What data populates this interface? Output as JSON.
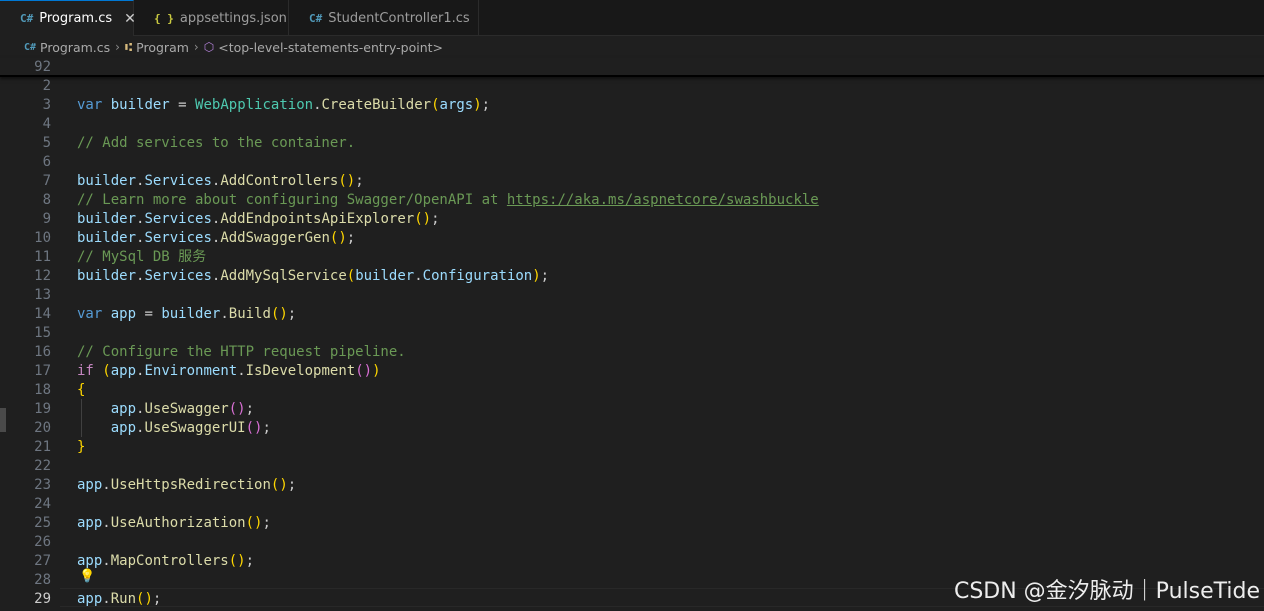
{
  "tabs": [
    {
      "icon": "C#",
      "label": "Program.cs",
      "close": "✕"
    },
    {
      "icon": "{ }",
      "label": "appsettings.json"
    },
    {
      "icon": "C#",
      "label": "StudentController1.cs"
    }
  ],
  "breadcrumb": {
    "items": [
      "Program.cs",
      "Program",
      "<top-level-statements-entry-point>"
    ]
  },
  "sticky_line_number": "92",
  "lines": [
    {
      "n": "2",
      "t": []
    },
    {
      "n": "3",
      "t": [
        [
          "kw",
          "var"
        ],
        [
          "txt",
          " "
        ],
        [
          "var",
          "builder"
        ],
        [
          "txt",
          " = "
        ],
        [
          "type",
          "WebApplication"
        ],
        [
          "txt",
          "."
        ],
        [
          "fn",
          "CreateBuilder"
        ],
        [
          "p1",
          "("
        ],
        [
          "var",
          "args"
        ],
        [
          "p1",
          ")"
        ],
        [
          "txt",
          ";"
        ]
      ]
    },
    {
      "n": "4",
      "t": []
    },
    {
      "n": "5",
      "t": [
        [
          "cmt",
          "// Add services to the container."
        ]
      ]
    },
    {
      "n": "6",
      "t": []
    },
    {
      "n": "7",
      "t": [
        [
          "var",
          "builder"
        ],
        [
          "txt",
          "."
        ],
        [
          "var",
          "Services"
        ],
        [
          "txt",
          "."
        ],
        [
          "fn",
          "AddControllers"
        ],
        [
          "p1",
          "()"
        ],
        [
          "txt",
          ";"
        ]
      ]
    },
    {
      "n": "8",
      "t": [
        [
          "cmt",
          "// Learn more about configuring Swagger/OpenAPI at "
        ],
        [
          "link",
          "https://aka.ms/aspnetcore/swashbuckle"
        ]
      ]
    },
    {
      "n": "9",
      "t": [
        [
          "var",
          "builder"
        ],
        [
          "txt",
          "."
        ],
        [
          "var",
          "Services"
        ],
        [
          "txt",
          "."
        ],
        [
          "fn",
          "AddEndpointsApiExplorer"
        ],
        [
          "p1",
          "()"
        ],
        [
          "txt",
          ";"
        ]
      ]
    },
    {
      "n": "10",
      "t": [
        [
          "var",
          "builder"
        ],
        [
          "txt",
          "."
        ],
        [
          "var",
          "Services"
        ],
        [
          "txt",
          "."
        ],
        [
          "fn",
          "AddSwaggerGen"
        ],
        [
          "p1",
          "()"
        ],
        [
          "txt",
          ";"
        ]
      ]
    },
    {
      "n": "11",
      "t": [
        [
          "cmt",
          "// MySql DB 服务"
        ]
      ]
    },
    {
      "n": "12",
      "t": [
        [
          "var",
          "builder"
        ],
        [
          "txt",
          "."
        ],
        [
          "var",
          "Services"
        ],
        [
          "txt",
          "."
        ],
        [
          "fn",
          "AddMySqlService"
        ],
        [
          "p1",
          "("
        ],
        [
          "var",
          "builder"
        ],
        [
          "txt",
          "."
        ],
        [
          "var",
          "Configuration"
        ],
        [
          "p1",
          ")"
        ],
        [
          "txt",
          ";"
        ]
      ]
    },
    {
      "n": "13",
      "t": []
    },
    {
      "n": "14",
      "t": [
        [
          "kw",
          "var"
        ],
        [
          "txt",
          " "
        ],
        [
          "var",
          "app"
        ],
        [
          "txt",
          " = "
        ],
        [
          "var",
          "builder"
        ],
        [
          "txt",
          "."
        ],
        [
          "fn",
          "Build"
        ],
        [
          "p1",
          "()"
        ],
        [
          "txt",
          ";"
        ]
      ]
    },
    {
      "n": "15",
      "t": []
    },
    {
      "n": "16",
      "t": [
        [
          "cmt",
          "// Configure the HTTP request pipeline."
        ]
      ]
    },
    {
      "n": "17",
      "t": [
        [
          "kw2",
          "if"
        ],
        [
          "txt",
          " "
        ],
        [
          "p1",
          "("
        ],
        [
          "var",
          "app"
        ],
        [
          "txt",
          "."
        ],
        [
          "var",
          "Environment"
        ],
        [
          "txt",
          "."
        ],
        [
          "fn",
          "IsDevelopment"
        ],
        [
          "p2",
          "()"
        ],
        [
          "p1",
          ")"
        ]
      ]
    },
    {
      "n": "18",
      "t": [
        [
          "p1",
          "{"
        ]
      ]
    },
    {
      "n": "19",
      "t": [
        [
          "txt",
          "    "
        ],
        [
          "var",
          "app"
        ],
        [
          "txt",
          "."
        ],
        [
          "fn",
          "UseSwagger"
        ],
        [
          "p2",
          "()"
        ],
        [
          "txt",
          ";"
        ]
      ]
    },
    {
      "n": "20",
      "t": [
        [
          "txt",
          "    "
        ],
        [
          "var",
          "app"
        ],
        [
          "txt",
          "."
        ],
        [
          "fn",
          "UseSwaggerUI"
        ],
        [
          "p2",
          "()"
        ],
        [
          "txt",
          ";"
        ]
      ]
    },
    {
      "n": "21",
      "t": [
        [
          "p1",
          "}"
        ]
      ]
    },
    {
      "n": "22",
      "t": []
    },
    {
      "n": "23",
      "t": [
        [
          "var",
          "app"
        ],
        [
          "txt",
          "."
        ],
        [
          "fn",
          "UseHttpsRedirection"
        ],
        [
          "p1",
          "()"
        ],
        [
          "txt",
          ";"
        ]
      ]
    },
    {
      "n": "24",
      "t": []
    },
    {
      "n": "25",
      "t": [
        [
          "var",
          "app"
        ],
        [
          "txt",
          "."
        ],
        [
          "fn",
          "UseAuthorization"
        ],
        [
          "p1",
          "()"
        ],
        [
          "txt",
          ";"
        ]
      ]
    },
    {
      "n": "26",
      "t": []
    },
    {
      "n": "27",
      "t": [
        [
          "var",
          "app"
        ],
        [
          "txt",
          "."
        ],
        [
          "fn",
          "MapControllers"
        ],
        [
          "p1",
          "()"
        ],
        [
          "txt",
          ";"
        ]
      ]
    },
    {
      "n": "28",
      "t": []
    },
    {
      "n": "29",
      "t": [
        [
          "var",
          "app"
        ],
        [
          "txt",
          "."
        ],
        [
          "fn",
          "Run"
        ],
        [
          "p1",
          "()"
        ],
        [
          "txt",
          ";"
        ]
      ]
    }
  ],
  "current_line": "29",
  "lightbulb_icon": "💡",
  "watermark": "CSDN @金汐脉动｜PulseTide",
  "colors": {
    "keyword": "#569cd6",
    "control_keyword": "#c586c0",
    "type": "#4ec9b0",
    "function": "#dcdcaa",
    "variable": "#9cdcfe",
    "comment": "#6a9955",
    "bracket_level1": "#ffd700",
    "bracket_level2": "#da70d6",
    "active_tab_border": "#0078d4"
  }
}
